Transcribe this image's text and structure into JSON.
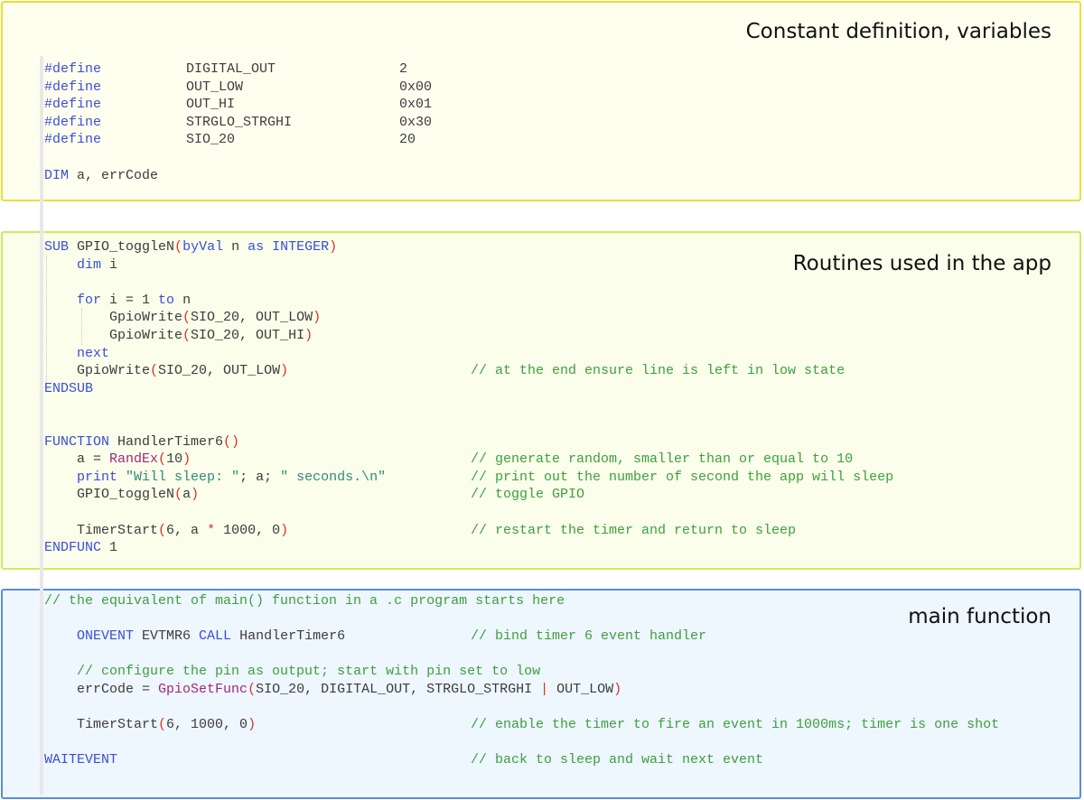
{
  "sections": {
    "constants": {
      "heading": "Constant definition, variables",
      "defines": [
        {
          "keyword": "#define",
          "name": "DIGITAL_OUT",
          "value": "2"
        },
        {
          "keyword": "#define",
          "name": "OUT_LOW",
          "value": "0x00"
        },
        {
          "keyword": "#define",
          "name": "OUT_HI",
          "value": "0x01"
        },
        {
          "keyword": "#define",
          "name": "STRGLO_STRGHI",
          "value": "0x30"
        },
        {
          "keyword": "#define",
          "name": "SIO_20",
          "value": "20"
        }
      ],
      "dim": {
        "keyword": "DIM",
        "rest": " a, errCode"
      }
    },
    "routines": {
      "heading": "Routines used in the app",
      "sub_header": {
        "kw1": "SUB",
        "name": " GPIO_toggleN",
        "open": "(",
        "kw2": "byVal",
        "mid": " n ",
        "kw3": "as",
        "kw4": "INTEGER",
        "close": ")"
      },
      "dim_i": {
        "kw": "dim",
        "rest": " i"
      },
      "for_line": {
        "kw1": "for",
        "mid": " i = 1 ",
        "kw2": "to",
        "rest": " n"
      },
      "gpio_low": {
        "name": "GpioWrite",
        "open": "(",
        "args": "SIO_20, OUT_LOW",
        "close": ")"
      },
      "gpio_hi": {
        "name": "GpioWrite",
        "open": "(",
        "args": "SIO_20, OUT_HI",
        "close": ")"
      },
      "next": "next",
      "gpio_final": {
        "name": "GpioWrite",
        "open": "(",
        "args": "SIO_20, OUT_LOW",
        "close": ")",
        "comment": "// at the end ensure line is left in low state"
      },
      "endsub": "ENDSUB",
      "func_header": {
        "kw": "FUNCTION",
        "name": " HandlerTimer6",
        "parens": "()"
      },
      "rand_line": {
        "pre": "a = ",
        "fn": "RandEx",
        "open": "(",
        "num": "10",
        "close": ")",
        "comment": "// generate random, smaller than or equal to 10"
      },
      "print_line": {
        "kw": "print",
        "str1": "\"Will sleep: \"",
        "mid": "; a; ",
        "str2": "\" seconds.\\n\"",
        "comment": "// print out the number of second the app will sleep"
      },
      "toggle_line": {
        "name": "GPIO_toggleN",
        "open": "(",
        "arg": "a",
        "close": ")",
        "comment": "// toggle GPIO"
      },
      "timer_line": {
        "name": "TimerStart",
        "open": "(",
        "a1": "6, a ",
        "op": "*",
        "a2": " 1000, 0",
        "close": ")",
        "comment": "// restart the timer and return to sleep"
      },
      "endfunc": {
        "kw": "ENDFUNC",
        "val": " 1"
      }
    },
    "main": {
      "heading": "main function",
      "intro_comment": "// the equivalent of main() function in a .c program starts here",
      "onevent": {
        "kw1": "ONEVENT",
        "mid": " EVTMR6 ",
        "kw2": "CALL",
        "rest": " HandlerTimer6",
        "comment": "// bind timer 6 event handler"
      },
      "config_comment": "// configure the pin as output; start with pin set to low",
      "errcode": {
        "pre": "errCode = ",
        "fn": "GpioSetFunc",
        "open": "(",
        "args": "SIO_20, DIGITAL_OUT, STRGLO_STRGHI ",
        "op": "|",
        "args2": " OUT_LOW",
        "close": ")"
      },
      "timerstart": {
        "name": "TimerStart",
        "open": "(",
        "args": "6, 1000, 0",
        "close": ")",
        "comment": "// enable the timer to fire an event in 1000ms; timer is one shot"
      },
      "waitevent": {
        "kw": "WAITEVENT",
        "comment": "// back to sleep and wait next event"
      }
    }
  }
}
